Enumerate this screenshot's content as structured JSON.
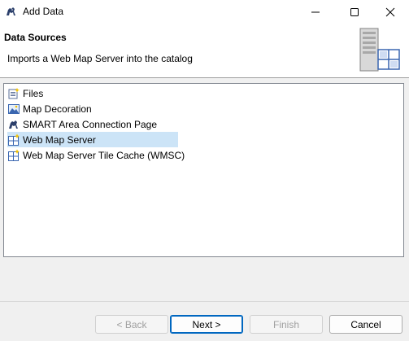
{
  "window": {
    "title": "Add Data",
    "minimize_glyph": "",
    "maximize_glyph": "",
    "close_glyph": ""
  },
  "header": {
    "title": "Data Sources",
    "description": "Imports a Web Map Server into the catalog"
  },
  "sources": [
    {
      "label": "Files",
      "icon": "files-icon",
      "selected": false
    },
    {
      "label": "Map Decoration",
      "icon": "map-decoration-icon",
      "selected": false
    },
    {
      "label": "SMART Area Connection Page",
      "icon": "smart-logo-icon",
      "selected": false
    },
    {
      "label": "Web Map Server",
      "icon": "web-map-server-icon",
      "selected": true
    },
    {
      "label": "Web Map Server Tile Cache (WMSC)",
      "icon": "web-map-server-icon",
      "selected": false
    }
  ],
  "buttons": {
    "back": "< Back",
    "next": "Next >",
    "finish": "Finish",
    "cancel": "Cancel"
  },
  "colors": {
    "selection": "#cce4f7",
    "default_button_border": "#0067c0"
  }
}
